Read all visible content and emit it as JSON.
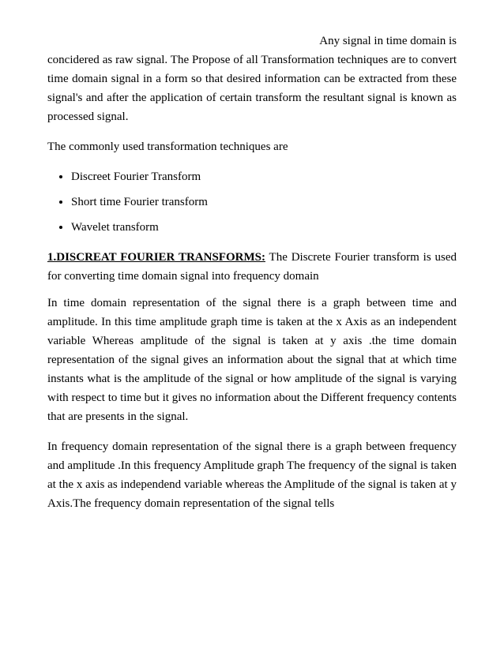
{
  "content": {
    "intro": {
      "line1": "Any signal in time domain is",
      "rest": "concidered  as raw signal. The Propose of all Transformation techniques are to convert time domain signal in a form  so that desired  information can be extracted from   these signal's and after the application of certain transform the resultant signal is known as processed signal."
    },
    "commonly_used": "The commonly used transformation techniques are",
    "bullet_items": [
      "Discreet Fourier Transform",
      "Short time Fourier transform",
      "Wavelet transform"
    ],
    "heading": {
      "bold_part": "1.DISCREAT FOURIER TRANSFORMS:",
      "rest": " The Discrete Fourier transform is used for converting time domain signal into frequency domain"
    },
    "para1": "In time domain representation of the signal there is a graph between time and amplitude. In this time amplitude graph time is taken at the x Axis as an independent variable Whereas amplitude of the signal is taken at y axis  .the time domain representation of the signal gives an information about the signal that at which time instants what is the amplitude of the signal or how amplitude of the signal is varying with respect to time but it gives no information about the Different frequency contents that are presents in the signal.",
    "para2": "In frequency domain representation of the signal there is a graph between frequency and amplitude .In this frequency Amplitude graph The frequency of the signal is taken at the x axis as independend variable whereas the Amplitude of the signal is taken at y Axis.The frequency domain representation of the signal tells"
  }
}
